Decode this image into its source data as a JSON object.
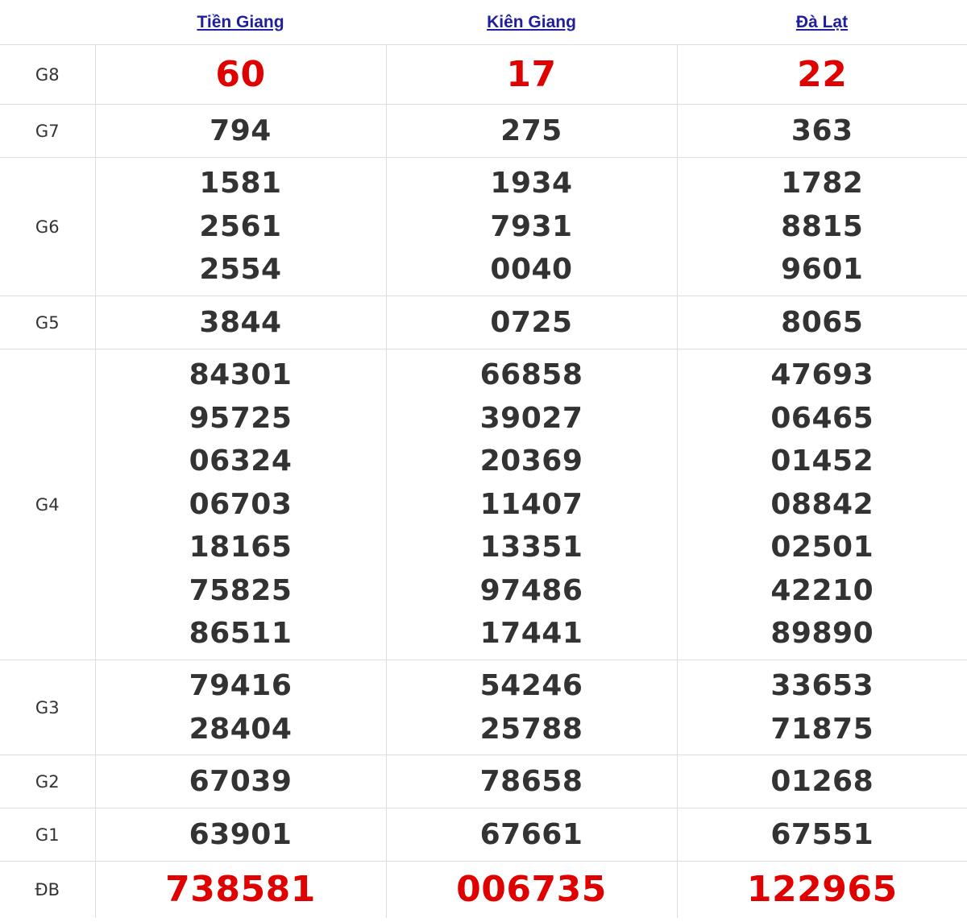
{
  "provinces": [
    "Tiền Giang",
    "Kiên Giang",
    "Đà Lạt"
  ],
  "prizes": {
    "g8": {
      "label": "G8",
      "values": [
        [
          "60"
        ],
        [
          "17"
        ],
        [
          "22"
        ]
      ]
    },
    "g7": {
      "label": "G7",
      "values": [
        [
          "794"
        ],
        [
          "275"
        ],
        [
          "363"
        ]
      ]
    },
    "g6": {
      "label": "G6",
      "values": [
        [
          "1581",
          "2561",
          "2554"
        ],
        [
          "1934",
          "7931",
          "0040"
        ],
        [
          "1782",
          "8815",
          "9601"
        ]
      ]
    },
    "g5": {
      "label": "G5",
      "values": [
        [
          "3844"
        ],
        [
          "0725"
        ],
        [
          "8065"
        ]
      ]
    },
    "g4": {
      "label": "G4",
      "values": [
        [
          "84301",
          "95725",
          "06324",
          "06703",
          "18165",
          "75825",
          "86511"
        ],
        [
          "66858",
          "39027",
          "20369",
          "11407",
          "13351",
          "97486",
          "17441"
        ],
        [
          "47693",
          "06465",
          "01452",
          "08842",
          "02501",
          "42210",
          "89890"
        ]
      ]
    },
    "g3": {
      "label": "G3",
      "values": [
        [
          "79416",
          "28404"
        ],
        [
          "54246",
          "25788"
        ],
        [
          "33653",
          "71875"
        ]
      ]
    },
    "g2": {
      "label": "G2",
      "values": [
        [
          "67039"
        ],
        [
          "78658"
        ],
        [
          "01268"
        ]
      ]
    },
    "g1": {
      "label": "G1",
      "values": [
        [
          "63901"
        ],
        [
          "67661"
        ],
        [
          "67551"
        ]
      ]
    },
    "db": {
      "label": "ĐB",
      "values": [
        [
          "738581"
        ],
        [
          "006735"
        ],
        [
          "122965"
        ]
      ]
    }
  },
  "colors": {
    "highlight": "#e00000",
    "link": "#1f1f9e",
    "text": "#333333",
    "border": "#dddddd"
  }
}
